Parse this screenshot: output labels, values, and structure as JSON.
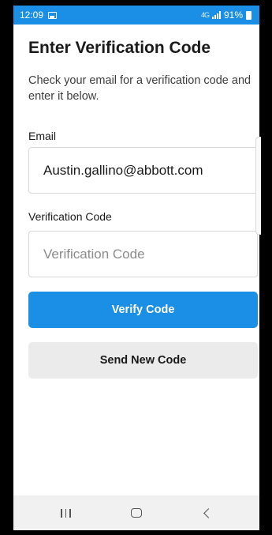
{
  "status_bar": {
    "time": "12:09",
    "battery": "91%",
    "network_indicator": "4G",
    "accent_color": "#1b8ee5"
  },
  "page": {
    "title": "Enter Verification Code",
    "instructions": "Check your email for a verification code and enter it below."
  },
  "form": {
    "email_label": "Email",
    "email_value": "Austin.gallino@abbott.com",
    "code_label": "Verification Code",
    "code_placeholder": "Verification Code",
    "code_value": ""
  },
  "actions": {
    "verify_label": "Verify Code",
    "send_new_label": "Send New Code"
  },
  "nav_bar": {
    "icons": [
      "recents-icon",
      "home-icon",
      "back-icon"
    ]
  }
}
